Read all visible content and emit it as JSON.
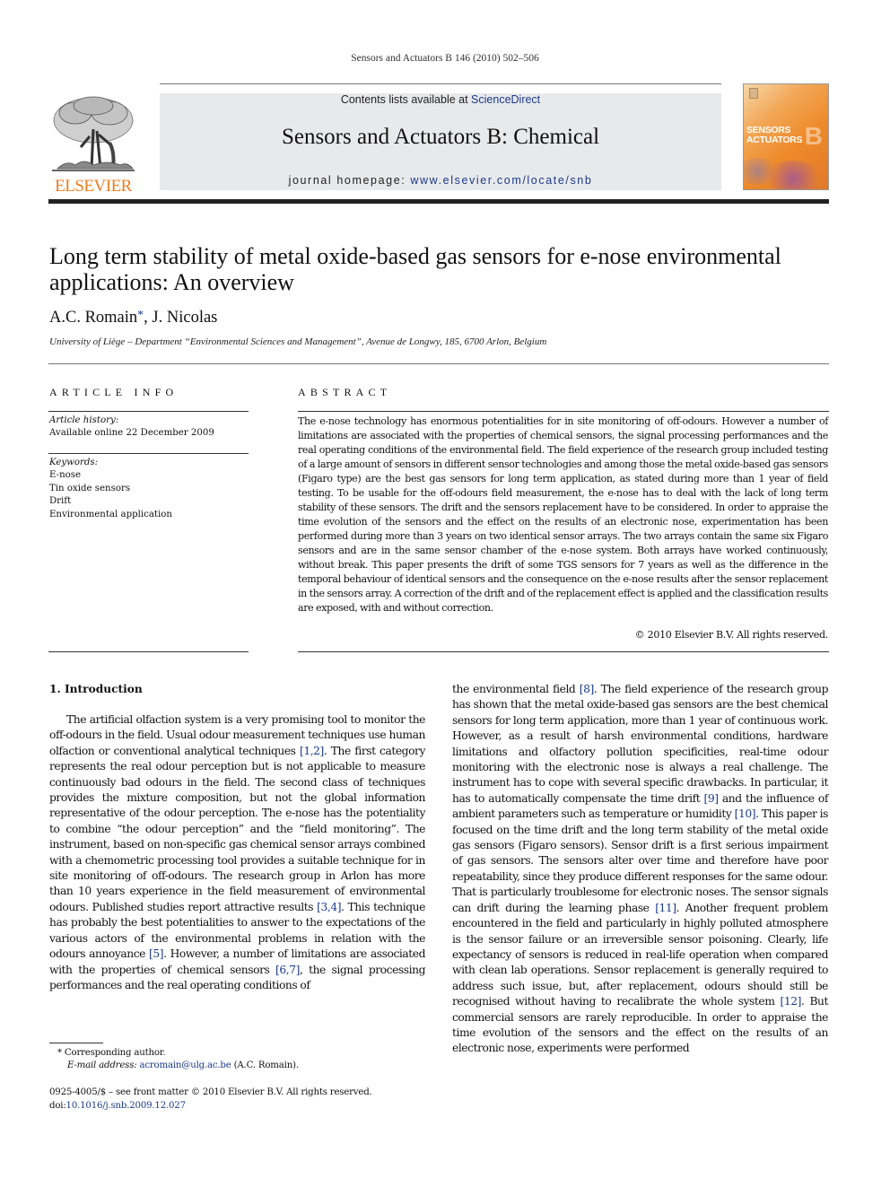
{
  "running_head": "Sensors and Actuators B 146 (2010) 502–506",
  "masthead": {
    "contents_prefix": "Contents lists available at ",
    "contents_link": "ScienceDirect",
    "journal_title": "Sensors and Actuators B: Chemical",
    "homepage_prefix": "journal homepage: ",
    "homepage_link": "www.elsevier.com/locate/snb",
    "publisher_logo_text": "ELSEVIER",
    "cover_title_line1": "SENSORS",
    "cover_title_line2": "ACTUATORS",
    "cover_letter": "B",
    "brand_color": "#ee7d1e",
    "link_color": "#1a3a8a"
  },
  "article": {
    "title": "Long term stability of metal oxide-based gas sensors for e-nose environmental applications: An overview",
    "authors": [
      {
        "name": "A.C. Romain",
        "mark": "*"
      },
      {
        "name": "J. Nicolas"
      }
    ],
    "author_separator": ", ",
    "affiliation": "University of Liège – Department “Environmental Sciences and Management”, Avenue de Longwy, 185, 6700 Arlon, Belgium"
  },
  "article_info": {
    "heading": "ARTICLE INFO",
    "history_label": "Article history:",
    "history_value": "Available online 22 December 2009",
    "keywords_label": "Keywords:",
    "keywords": [
      "E-nose",
      "Tin oxide sensors",
      "Drift",
      "Environmental application"
    ]
  },
  "abstract": {
    "heading": "ABSTRACT",
    "text": "The e-nose technology has enormous potentialities for in site monitoring of off-odours. However a number of limitations are associated with the properties of chemical sensors, the signal processing performances and the real operating conditions of the environmental field. The field experience of the research group included testing of a large amount of sensors in different sensor technologies and among those the metal oxide-based gas sensors (Figaro type) are the best gas sensors for long term application, as stated during more than 1 year of field testing. To be usable for the off-odours field measurement, the e-nose has to deal with the lack of long term stability of these sensors. The drift and the sensors replacement have to be considered. In order to appraise the time evolution of the sensors and the effect on the results of an electronic nose, experimentation has been performed during more than 3 years on two identical sensor arrays. The two arrays contain the same six Figaro sensors and are in the same sensor chamber of the e-nose system. Both arrays have worked continuously, without break. This paper presents the drift of some TGS sensors for 7 years as well as the difference in the temporal behaviour of identical sensors and the consequence on the e-nose results after the sensor replacement in the sensors array. A correction of the drift and of the replacement effect is applied and the classification results are exposed, with and without correction.",
    "copyright": "© 2010 Elsevier B.V. All rights reserved."
  },
  "introduction": {
    "heading": "1.  Introduction",
    "left_column": [
      {
        "t": "The artificial olfaction system is a very promising tool to monitor the off-odours in the field. Usual odour measurement techniques use human olfaction or conventional analytical techniques "
      },
      {
        "ref": "[1,2]"
      },
      {
        "t": ". The first category represents the real odour perception but is not applicable to measure continuously bad odours in the field. The second class of techniques provides the mixture composition, but not the global information representative of the odour perception. The e-nose has the potentiality to combine “the odour perception” and the “field monitoring”. The instrument, based on non-specific gas chemical sensor arrays combined with a chemometric pro­cessing tool provides a suitable technique for in site monitoring of off-odours. The research group in Arlon has more than 10 years experience in the field measurement of environmental odours. Pub­lished studies report attractive results "
      },
      {
        "ref": "[3,4]"
      },
      {
        "t": ". This technique has probably the best potentialities to answer to the expectations of the various actors of the environmental problems in relation with the odours annoyance "
      },
      {
        "ref": "[5]"
      },
      {
        "t": ". However, a number of limitations are associated with the properties of chemical sensors "
      },
      {
        "ref": "[6,7]"
      },
      {
        "t": ", the sig­nal processing performances and the real operating conditions of"
      }
    ],
    "right_column": [
      {
        "t": "the environmental field "
      },
      {
        "ref": "[8]"
      },
      {
        "t": ". The field experience of the research group has shown that the metal oxide-based gas sensors are the best chemical sensors for long term application, more than 1 year of continuous work. However, as a result of harsh environmental conditions, hardware limitations and olfactory pollution specifici­ties, real-time odour monitoring with the electronic nose is always a real challenge. The instrument has to cope with several specific drawbacks. In particular, it has to automatically compensate the time drift "
      },
      {
        "ref": "[9]"
      },
      {
        "t": " and the influence of ambient parameters such as tem­perature or humidity "
      },
      {
        "ref": "[10]"
      },
      {
        "t": ". This paper is focused on the time drift and the long term stability of the metal oxide gas sensors (Figaro sensors). Sensor drift is a first serious impairment of gas sensors. The sensors alter over time and therefore have poor repeatability, since they produce different responses for the same odour. That is particularly troublesome for electronic noses. The sensor signals can drift during the learning phase "
      },
      {
        "ref": "[11]"
      },
      {
        "t": ". Another frequent prob­lem encountered in the field and particularly in highly polluted atmosphere is the sensor failure or an irreversible sensor poisoning. Clearly, life expectancy of sensors is reduced in real-life operation when compared with clean lab operations. Sensor replacement is generally required to address such issue, but, after replacement, odours should still be recognised without having to recalibrate the whole system "
      },
      {
        "ref": "[12]"
      },
      {
        "t": ". But commercial sensors are rarely reproducible. In order to appraise the time evolution of the sensors and the effect on the results of an electronic nose, experiments were performed"
      }
    ]
  },
  "footnotes": {
    "corresponding": "*  Corresponding author.",
    "email_label": "E-mail address: ",
    "email": "acromain@ulg.ac.be",
    "email_suffix": " (A.C. Romain).",
    "front_matter": "0925-4005/$ – see front matter © 2010 Elsevier B.V. All rights reserved.",
    "doi_prefix": "doi:",
    "doi": "10.1016/j.snb.2009.12.027"
  }
}
